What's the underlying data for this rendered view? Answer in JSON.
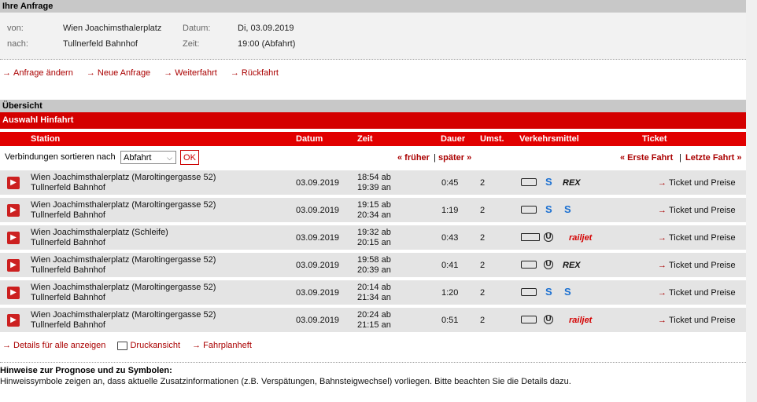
{
  "request": {
    "header": "Ihre Anfrage",
    "from_label": "von:",
    "from_value": "Wien Joachimsthalerplatz",
    "to_label": "nach:",
    "to_value": "Tullnerfeld Bahnhof",
    "date_label": "Datum:",
    "date_value": "Di, 03.09.2019",
    "time_label": "Zeit:",
    "time_value": "19:00 (Abfahrt)"
  },
  "actions": [
    "Anfrage ändern",
    "Neue Anfrage",
    "Weiterfahrt",
    "Rückfahrt"
  ],
  "overview": {
    "header": "Übersicht",
    "subheader": "Auswahl Hinfahrt",
    "columns": [
      "Station",
      "Datum",
      "Zeit",
      "Dauer",
      "Umst.",
      "Verkehrsmittel",
      "Ticket"
    ],
    "sort_label": "Verbindungen sortieren nach",
    "sort_value": "Abfahrt",
    "ok_label": "OK",
    "earlier": "« früher",
    "later": "später »",
    "first": "« Erste Fahrt",
    "last": "Letzte Fahrt »"
  },
  "connections": [
    {
      "from": "Wien Joachimsthalerplatz (Maroltingergasse 52)",
      "to": "Tullnerfeld Bahnhof",
      "date": "03.09.2019",
      "dep": "18:54 ab",
      "arr": "19:39 an",
      "dur": "0:45",
      "chg": "2",
      "modes": [
        "bus",
        "sbahn",
        "rex"
      ],
      "ticket": "Ticket und Preise"
    },
    {
      "from": "Wien Joachimsthalerplatz (Maroltingergasse 52)",
      "to": "Tullnerfeld Bahnhof",
      "date": "03.09.2019",
      "dep": "19:15 ab",
      "arr": "20:34 an",
      "dur": "1:19",
      "chg": "2",
      "modes": [
        "bus",
        "sbahn",
        "sbahn"
      ],
      "ticket": "Ticket und Preise"
    },
    {
      "from": "Wien Joachimsthalerplatz (Schleife)",
      "to": "Tullnerfeld Bahnhof",
      "date": "03.09.2019",
      "dep": "19:32 ab",
      "arr": "20:15 an",
      "dur": "0:43",
      "chg": "2",
      "modes": [
        "tram",
        "ubahn",
        "railjet"
      ],
      "ticket": "Ticket und Preise"
    },
    {
      "from": "Wien Joachimsthalerplatz (Maroltingergasse 52)",
      "to": "Tullnerfeld Bahnhof",
      "date": "03.09.2019",
      "dep": "19:58 ab",
      "arr": "20:39 an",
      "dur": "0:41",
      "chg": "2",
      "modes": [
        "bus",
        "ubahn",
        "rex"
      ],
      "ticket": "Ticket und Preise"
    },
    {
      "from": "Wien Joachimsthalerplatz (Maroltingergasse 52)",
      "to": "Tullnerfeld Bahnhof",
      "date": "03.09.2019",
      "dep": "20:14 ab",
      "arr": "21:34 an",
      "dur": "1:20",
      "chg": "2",
      "modes": [
        "bus",
        "sbahn",
        "sbahn"
      ],
      "ticket": "Ticket und Preise"
    },
    {
      "from": "Wien Joachimsthalerplatz (Maroltingergasse 52)",
      "to": "Tullnerfeld Bahnhof",
      "date": "03.09.2019",
      "dep": "20:24 ab",
      "arr": "21:15 an",
      "dur": "0:51",
      "chg": "2",
      "modes": [
        "bus",
        "ubahn",
        "railjet"
      ],
      "ticket": "Ticket und Preise"
    }
  ],
  "mode_labels": {
    "rex": "REX",
    "railjet": "railjet",
    "ubahn": "U",
    "sbahn": "S"
  },
  "footer_links": [
    "Details für alle anzeigen",
    "Druckansicht",
    "Fahrplanheft"
  ],
  "hints": {
    "title": "Hinweise zur Prognose und zu Symbolen:",
    "text": "Hinweissymbole zeigen an, dass aktuelle Zusatzinformationen (z.B. Verspätungen, Bahnsteigwechsel) vorliegen. Bitte beachten Sie die Details dazu."
  }
}
